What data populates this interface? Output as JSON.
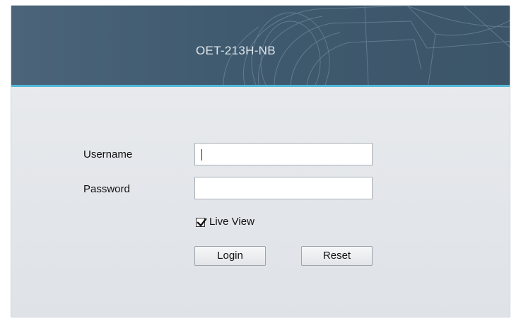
{
  "header": {
    "device_name": "OET-213H-NB"
  },
  "form": {
    "username_label": "Username",
    "username_value": "",
    "password_label": "Password",
    "password_value": "",
    "live_view_label": "Live View",
    "live_view_checked": true,
    "login_label": "Login",
    "reset_label": "Reset"
  },
  "colors": {
    "header_bg": "#3f596e",
    "header_accent": "#53b8da",
    "panel_bg": "#e6e9ec"
  },
  "icons": {
    "checkbox": "checkmark-icon"
  }
}
